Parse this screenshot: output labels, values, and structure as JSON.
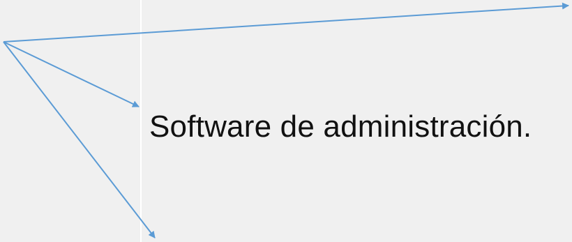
{
  "diagram": {
    "label": "Software de administración.",
    "colors": {
      "background": "#f0f0f0",
      "arrow": "#5b9bd5",
      "divider": "#ffffff",
      "text": "#111111"
    }
  }
}
